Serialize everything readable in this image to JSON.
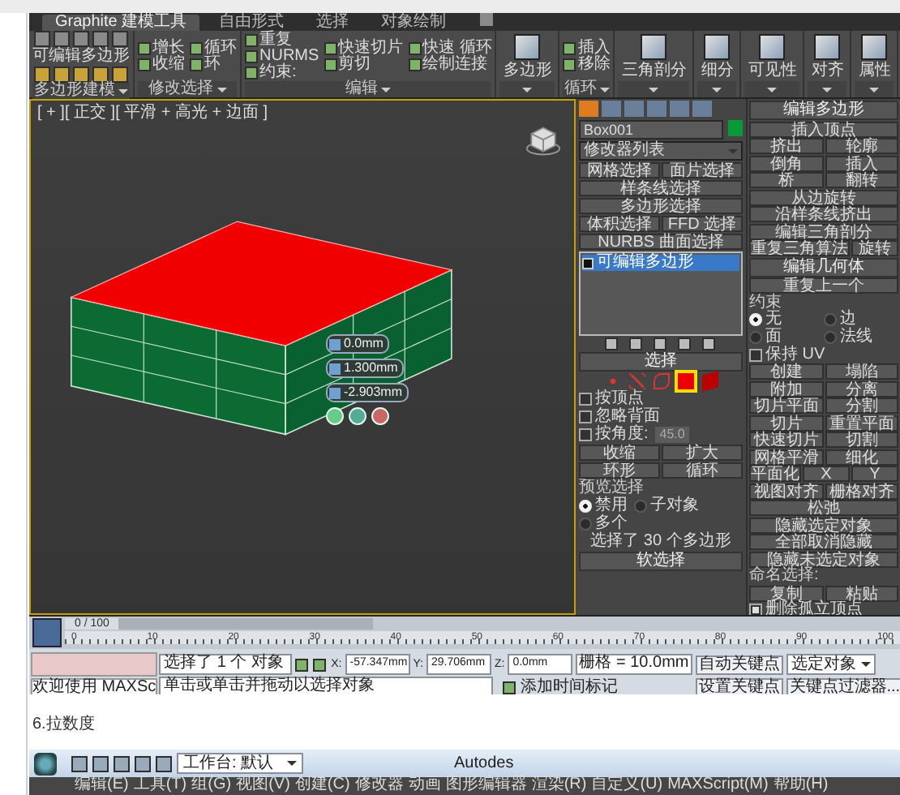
{
  "screenshot_1": {
    "ribbon": {
      "tabs": [
        {
          "label": "Graphite 建模工具",
          "selected": true
        },
        {
          "label": "自由形式",
          "selected": false
        },
        {
          "label": "选择",
          "selected": false
        },
        {
          "label": "对象绘制",
          "selected": false
        }
      ],
      "panels": [
        {
          "kind": "polygon_modeling",
          "title": "可编辑多边形",
          "label": "多边形建模"
        },
        {
          "kind": "tools",
          "label": "修改选择",
          "columns": [
            [
              "增长",
              "收缩"
            ],
            [
              "循环",
              "环"
            ]
          ]
        },
        {
          "kind": "tools",
          "label": "编辑",
          "columns": [
            [
              "重复",
              "NURMS",
              "约束:"
            ],
            [
              "快速切片",
              "剪切"
            ],
            [
              "快速 循环",
              "绘制连接"
            ]
          ]
        },
        {
          "kind": "big",
          "title": "多边形"
        },
        {
          "kind": "tools",
          "label": "循环",
          "columns": [
            [
              "插入",
              "移除"
            ]
          ]
        },
        {
          "kind": "big",
          "title": "三角剖分"
        },
        {
          "kind": "big",
          "title": "细分"
        },
        {
          "kind": "big",
          "title": "可见性"
        },
        {
          "kind": "big",
          "title": "对齐"
        },
        {
          "kind": "big",
          "title": "属性"
        }
      ]
    },
    "viewport": {
      "label": "[ + ][ 正交 ][ 平滑 + 高光 + 边面 ]",
      "caddy": [
        "0.0mm",
        "1.300mm",
        "-2.903mm"
      ]
    },
    "command_panel": {
      "object_name": "Box001",
      "modifier_list": "修改器列表",
      "modifier_buttons": [
        [
          "网格选择",
          "面片选择"
        ],
        [
          "样条线选择"
        ],
        [
          "多边形选择"
        ],
        [
          "体积选择",
          "FFD 选择"
        ],
        [
          "NURBS 曲面选择"
        ]
      ],
      "stack": [
        {
          "label": "可编辑多边形",
          "selected": true
        }
      ],
      "selection": {
        "title": "选择",
        "levels": [
          {
            "kind": "vertex",
            "selected": false
          },
          {
            "kind": "edge",
            "selected": false
          },
          {
            "kind": "border",
            "selected": false
          },
          {
            "kind": "polygon",
            "selected": true
          },
          {
            "kind": "element",
            "selected": false
          }
        ],
        "checks": [
          {
            "label": "按顶点",
            "checked": false
          },
          {
            "label": "忽略背面",
            "checked": false
          },
          {
            "label": "按角度:",
            "checked": false
          }
        ],
        "angle": "45.0",
        "buttons": [
          [
            "收缩",
            "扩大"
          ],
          [
            "环形",
            "循环"
          ]
        ],
        "preview_title": "预览选择",
        "preview": [
          {
            "label": "禁用",
            "selected": true
          },
          {
            "label": "子对象",
            "selected": false
          },
          {
            "label": "多个",
            "selected": false
          }
        ],
        "summary": "选择了 30 个多边形"
      },
      "soft_selection": "软选择",
      "edit_poly": {
        "title": "编辑多边形",
        "rows": [
          [
            "插入顶点"
          ],
          [
            "挤出",
            "轮廓"
          ],
          [
            "倒角",
            "插入"
          ],
          [
            "桥",
            "翻转"
          ],
          [
            "从边旋转"
          ],
          [
            "沿样条线挤出"
          ],
          [
            "编辑三角剖分"
          ],
          [
            "重复三角算法",
            "旋转"
          ]
        ]
      },
      "edit_geometry": {
        "title": "编辑几何体",
        "repeat": "重复上一个",
        "constraints_label": "约束",
        "constraints": [
          {
            "label": "无",
            "selected": true
          },
          {
            "label": "边",
            "selected": false
          },
          {
            "label": "面",
            "selected": false
          },
          {
            "label": "法线",
            "selected": false
          }
        ],
        "preserve_uv": {
          "label": "保持 UV",
          "checked": false
        },
        "rows": [
          [
            "创建",
            "塌陷"
          ],
          [
            "附加",
            "分离"
          ],
          [
            "切片平面",
            "分割"
          ],
          [
            "切片",
            "重置平面"
          ],
          [
            "快速切片",
            "切割"
          ],
          [
            "网格平滑",
            "细化"
          ],
          [
            "平面化",
            "X",
            "Y"
          ],
          [
            "视图对齐",
            "栅格对齐"
          ],
          [
            "松弛"
          ],
          [
            "隐藏选定对象"
          ],
          [
            "全部取消隐藏"
          ],
          [
            "隐藏未选定对象"
          ]
        ],
        "named_selection": "命名选择:",
        "named_buttons": [
          "复制",
          "粘贴"
        ],
        "delete_isolated": {
          "label": "删除孤立顶点",
          "checked": true
        }
      }
    },
    "timeline": {
      "position": "0 / 100",
      "level": 0,
      "ticks": [
        "0",
        "10",
        "20",
        "30",
        "40",
        "50",
        "60",
        "70",
        "80",
        "90",
        "100"
      ]
    },
    "status": {
      "welcome": "欢迎使用 MAXSc",
      "selected": "选择了 1 个 对象",
      "prompt": "单击或单击并拖动以选择对象",
      "coords": [
        {
          "label": "X:",
          "value": "-57.347mm"
        },
        {
          "label": "Y:",
          "value": "29.706mm"
        },
        {
          "label": "Z:",
          "value": "0.0mm"
        }
      ],
      "grid": "栅格 = 10.0mm",
      "time_tag": "添加时间标记",
      "auto_key": "自动关键点",
      "key_target": "选定对象",
      "set_key": "设置关键点",
      "key_filters": "关键点过滤器..."
    }
  },
  "page_heading": "6.拉数度",
  "screenshot_2": {
    "workspace": "工作台: 默认",
    "title": "Autodes",
    "menu": [
      "编辑(E)",
      "工具(T)",
      "组(G)",
      "视图(V)",
      "创建(C)",
      "修改器",
      "动画",
      "图形编辑器",
      "渲染(R)",
      "自定义(U)",
      "MAXScript(M)",
      "帮助(H)"
    ]
  }
}
